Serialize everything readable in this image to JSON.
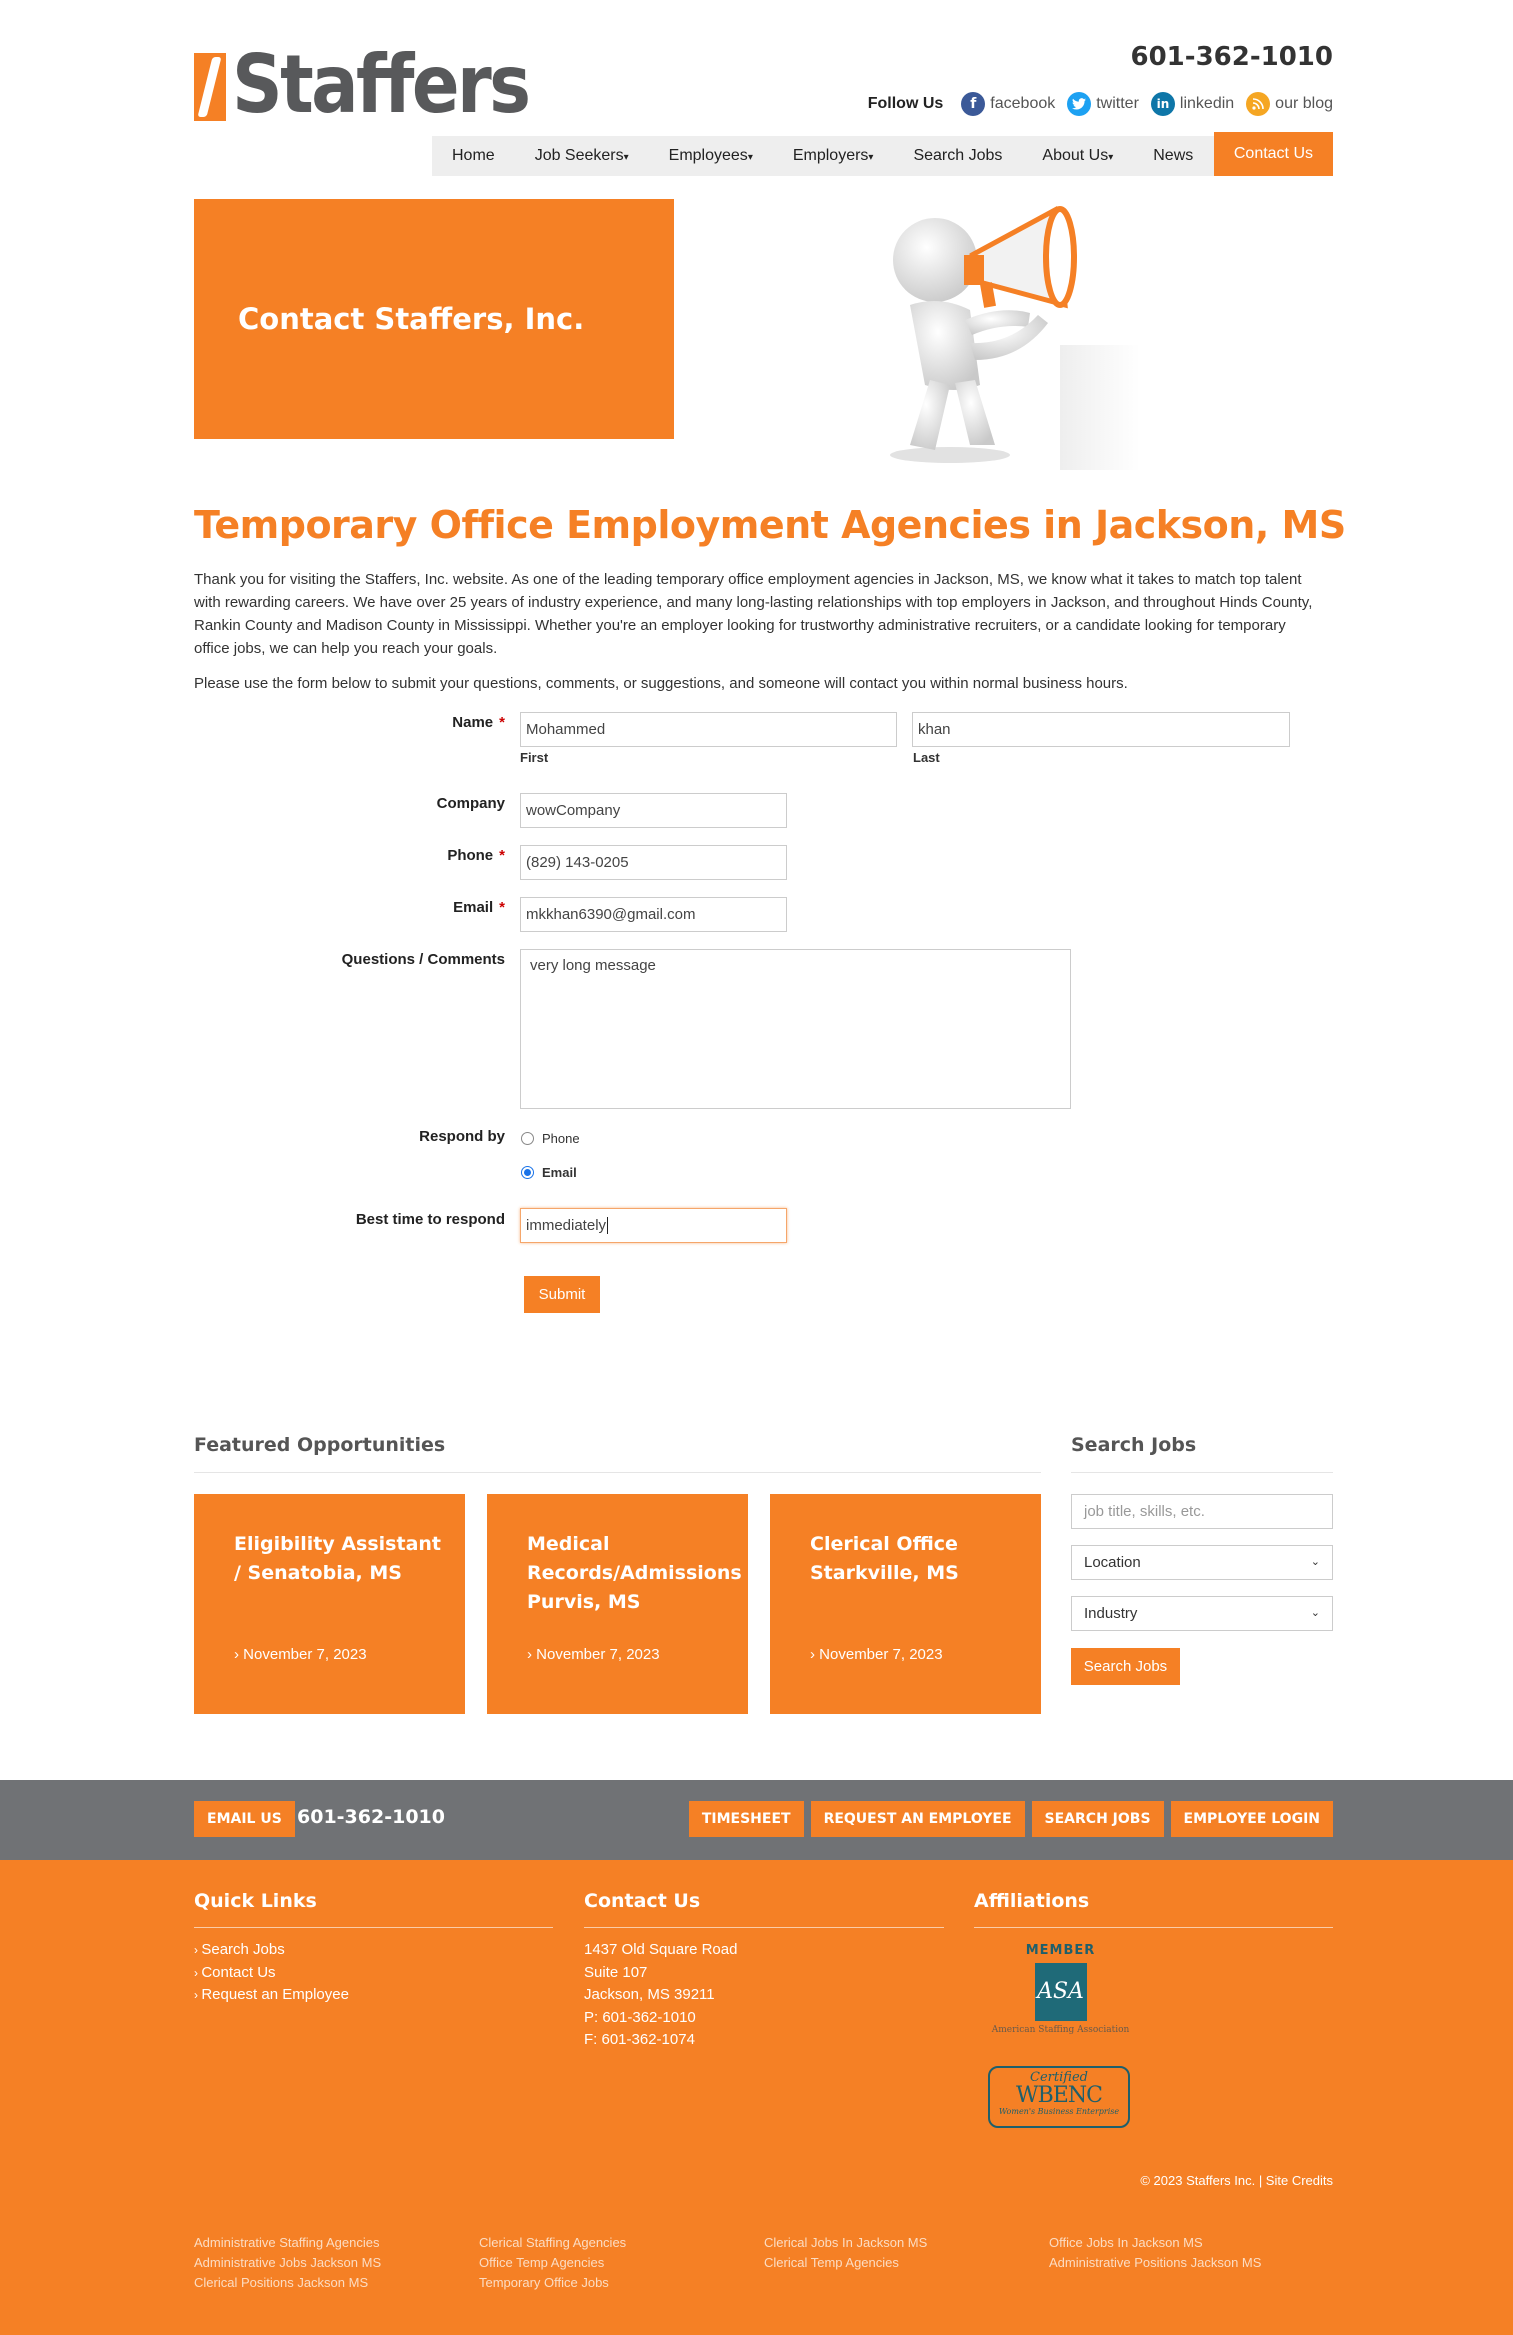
{
  "header": {
    "logo_text": "Staffers",
    "phone": "601-362-1010",
    "follow_label": "Follow Us",
    "social": [
      {
        "icon": "facebook-icon",
        "label": "facebook",
        "color": "#3b5998"
      },
      {
        "icon": "twitter-icon",
        "label": "twitter",
        "color": "#1da1f2"
      },
      {
        "icon": "linkedin-icon",
        "label": "linkedin",
        "color": "#0e76a8"
      },
      {
        "icon": "blog-icon",
        "label": "our blog",
        "color": "#f5a623"
      }
    ]
  },
  "nav": [
    {
      "label": "Home",
      "dropdown": false
    },
    {
      "label": "Job Seekers",
      "dropdown": true
    },
    {
      "label": "Employees",
      "dropdown": true
    },
    {
      "label": "Employers",
      "dropdown": true
    },
    {
      "label": "Search Jobs",
      "dropdown": false
    },
    {
      "label": "About Us",
      "dropdown": true
    },
    {
      "label": "News",
      "dropdown": false
    },
    {
      "label": "Contact Us",
      "dropdown": false,
      "active": true
    }
  ],
  "hero": {
    "title": "Contact Staffers, Inc."
  },
  "main": {
    "heading": "Temporary Office Employment Agencies in Jackson, MS",
    "intro": "Thank you for visiting the Staffers, Inc. website. As one of the leading temporary office employment agencies in Jackson, MS, we know what it takes to match top talent with rewarding careers. We have over 25 years of industry experience, and many long-lasting relationships with top employers in Jackson, and throughout Hinds County, Rankin County and Madison County in Mississippi. Whether you're an employer looking for trustworthy administrative recruiters, or a candidate looking for temporary office jobs, we can help you reach your goals.",
    "instructions": "Please use the form below to submit your questions, comments, or suggestions, and someone will contact you within normal business hours."
  },
  "form": {
    "name_label": "Name",
    "first_value": "Mohammed",
    "first_sub": "First",
    "last_value": "khan",
    "last_sub": "Last",
    "company_label": "Company",
    "company_value": "wowCompany",
    "phone_label": "Phone",
    "phone_value": "(829) 143-0205",
    "email_label": "Email",
    "email_value": "mkkhan6390@gmail.com",
    "comments_label": "Questions / Comments",
    "comments_value": "very long message",
    "respond_label": "Respond by",
    "respond_options": [
      "Phone",
      "Email"
    ],
    "respond_selected": "Email",
    "besttime_label": "Best time to respond",
    "besttime_value": "immediately",
    "submit_label": "Submit",
    "required_mark": "*"
  },
  "featured": {
    "title": "Featured Opportunities",
    "cards": [
      {
        "title": "Eligibility Assistant / Senatobia, MS",
        "date": "November 7, 2023"
      },
      {
        "title": "Medical Records/Admissions Purvis, MS",
        "date": "November 7, 2023"
      },
      {
        "title": "Clerical Office Starkville, MS",
        "date": "November 7, 2023"
      }
    ]
  },
  "search": {
    "title": "Search Jobs",
    "placeholder": "job title, skills, etc.",
    "location": "Location",
    "industry": "Industry",
    "button": "Search Jobs"
  },
  "footer_bar": {
    "email_btn": "EMAIL US",
    "phone": "601-362-1010",
    "buttons": [
      "TIMESHEET",
      "REQUEST AN EMPLOYEE",
      "SEARCH JOBS",
      "EMPLOYEE LOGIN"
    ]
  },
  "footer": {
    "quick_links_title": "Quick Links",
    "quick_links": [
      "Search Jobs",
      "Contact Us",
      "Request an Employee"
    ],
    "contact_title": "Contact Us",
    "contact_lines": [
      "1437 Old Square Road",
      "Suite 107",
      "Jackson, MS 39211",
      "P: 601-362-1010",
      "F: 601-362-1074"
    ],
    "affiliations_title": "Affiliations",
    "asa_member": "MEMBER",
    "asa_logo": "ASA",
    "asa_name": "American Staffing Association",
    "wbenc_certified": "Certified",
    "wbenc_logo": "WBENC",
    "wbenc_name": "Women's Business Enterprise",
    "copyright": "© 2023 Staffers Inc. | Site Credits",
    "seo_cols": [
      [
        "Administrative Staffing Agencies",
        "Administrative Jobs Jackson MS",
        "Clerical Positions Jackson MS"
      ],
      [
        "Clerical Staffing Agencies",
        "Office Temp Agencies",
        "Temporary Office Jobs"
      ],
      [
        "Clerical Jobs In Jackson MS",
        "Clerical Temp Agencies"
      ],
      [
        "Office Jobs In Jackson MS",
        "Administrative Positions Jackson MS"
      ]
    ]
  }
}
